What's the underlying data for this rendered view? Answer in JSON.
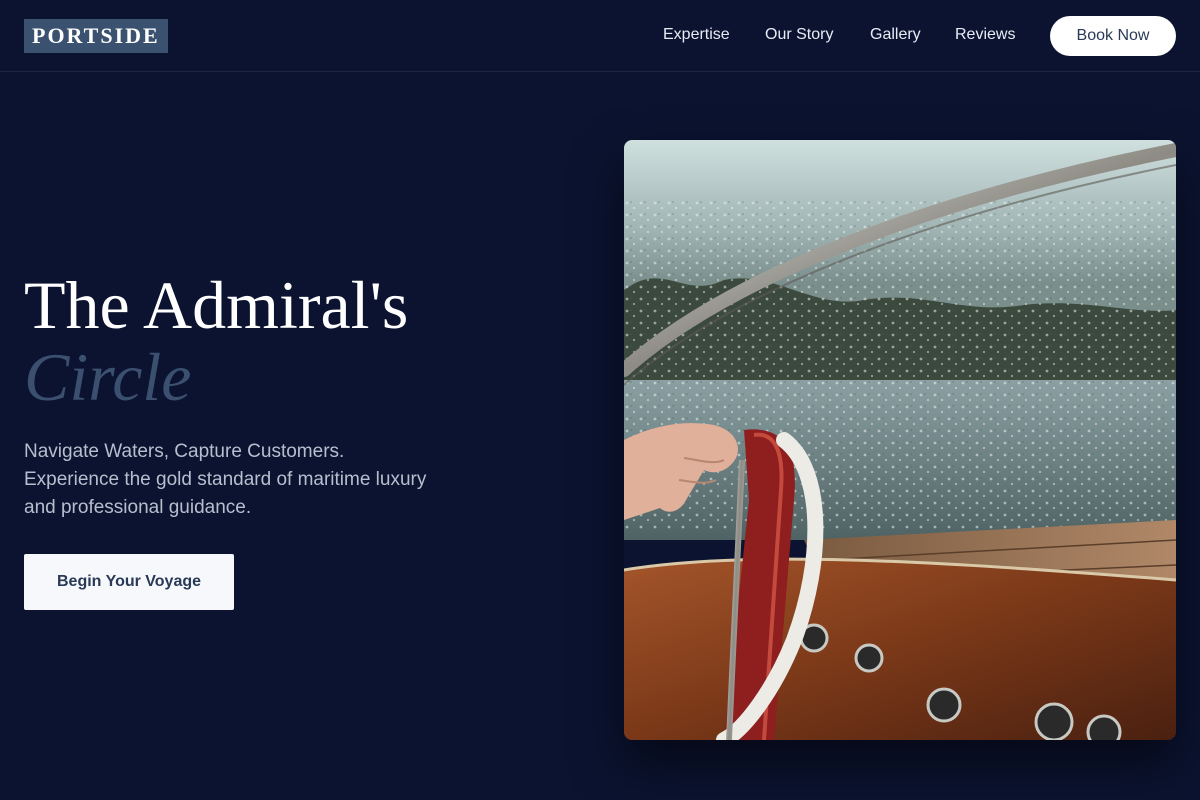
{
  "brand": {
    "logo_text": "PORTSIDE"
  },
  "nav": {
    "items": [
      {
        "label": "Expertise"
      },
      {
        "label": "Our Story"
      },
      {
        "label": "Gallery"
      },
      {
        "label": "Reviews"
      }
    ],
    "cta_label": "Book Now"
  },
  "hero": {
    "title": "The Admiral's",
    "title_accent": "Circle",
    "description": "Navigate Waters, Capture Customers. Experience the gold standard of maritime luxury and professional guidance.",
    "cta_label": "Begin Your Voyage",
    "image": {
      "subject": "boat-steering-wheel-photo"
    }
  },
  "colors": {
    "background": "#0b1330",
    "logo_bg": "#3b5170",
    "accent_text": "#3b4f6e",
    "button_bg": "#ffffff",
    "button_text": "#2a3a56"
  }
}
